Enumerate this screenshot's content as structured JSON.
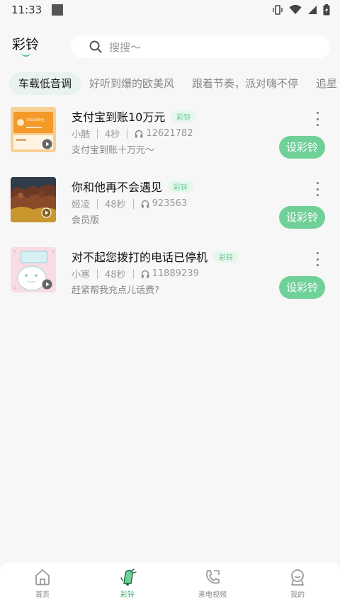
{
  "status_bar": {
    "time": "11:33"
  },
  "header": {
    "title": "彩铃"
  },
  "search": {
    "placeholder": "搜搜～"
  },
  "tabs": [
    {
      "label": "车载低音调",
      "active": true
    },
    {
      "label": "好听到爆的欧美风"
    },
    {
      "label": "跟着节奏，派对嗨不停"
    },
    {
      "label": "追星"
    }
  ],
  "songs": [
    {
      "title": "支付宝到账10万元",
      "badge": "彩铃",
      "artist": "小酷",
      "duration": "4秒",
      "plays": "12621782",
      "desc": "支付宝到账十万元～",
      "cover_text": "100,000元",
      "action": "设彩铃"
    },
    {
      "title": "你和他再不会遇见",
      "badge": "彩铃",
      "artist": "姬凌",
      "duration": "48秒",
      "plays": "923563",
      "desc": "会员版",
      "action": "设彩铃"
    },
    {
      "title": "对不起您拨打的电话已停机",
      "badge": "彩铃",
      "artist": "小寒",
      "duration": "48秒",
      "plays": "11889239",
      "desc": "赶紧帮我充点儿话费?",
      "action": "设彩铃"
    }
  ],
  "nav": [
    {
      "label": "首页",
      "icon": "home-icon"
    },
    {
      "label": "彩铃",
      "icon": "ringtone-icon",
      "active": true
    },
    {
      "label": "来电视频",
      "icon": "call-video-icon"
    },
    {
      "label": "我的",
      "icon": "profile-icon"
    }
  ],
  "colors": {
    "accent": "#6fd098",
    "accent_text": "#3ab26f",
    "tab_active_bg": "#e8f3ed"
  }
}
